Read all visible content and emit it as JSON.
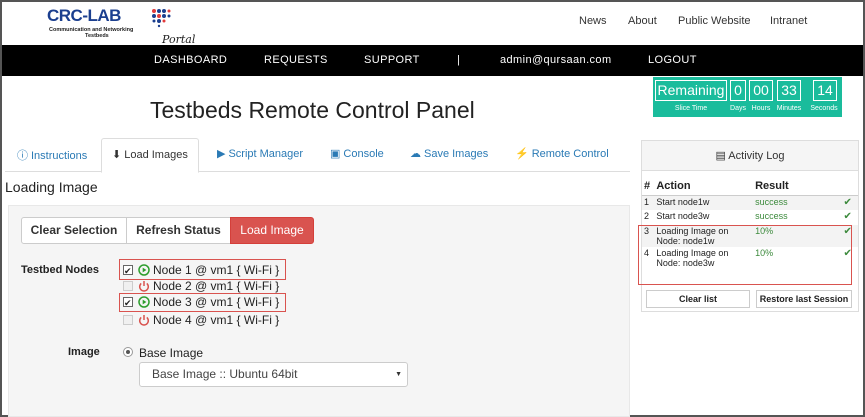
{
  "logo": {
    "main": "CRC-LAB",
    "sub_line1": "Communication and Networking",
    "sub_line2": "Testbeds",
    "portal": "Portal"
  },
  "top_nav": [
    "News",
    "About",
    "Public Website",
    "Intranet"
  ],
  "main_nav": [
    "DASHBOARD",
    "REQUESTS",
    "SUPPORT",
    "|",
    "admin@qursaan.com",
    "LOGOUT"
  ],
  "timer": {
    "label": "Remaining",
    "sublabel": "Slice Time",
    "days": "0",
    "hours": "00",
    "minutes": "33",
    "seconds": "14",
    "days_label": "Days",
    "hours_label": "Hours",
    "minutes_label": "Minutes",
    "seconds_label": "Seconds"
  },
  "page_title": "Testbeds Remote Control Panel",
  "tabs": [
    "Instructions",
    "Load Images",
    "Script Manager",
    "Console",
    "Save Images",
    "Remote Control"
  ],
  "section_title": "Loading Image",
  "buttons": {
    "clear": "Clear Selection",
    "refresh": "Refresh Status",
    "load": "Load Image"
  },
  "nodes_label": "Testbed Nodes",
  "nodes": [
    {
      "text": "Node 1 @ vm1 { Wi-Fi }",
      "checked": true,
      "state": "on"
    },
    {
      "text": "Node 2 @ vm1 { Wi-Fi }",
      "checked": false,
      "state": "off"
    },
    {
      "text": "Node 3 @ vm1 { Wi-Fi }",
      "checked": true,
      "state": "on"
    },
    {
      "text": "Node 4 @ vm1 { Wi-Fi }",
      "checked": false,
      "state": "off"
    }
  ],
  "image_label": "Image",
  "image_radio": "Base Image",
  "image_select": "Base Image :: Ubuntu 64bit",
  "activity_log": {
    "title": "Activity Log",
    "headers": [
      "#",
      "Action",
      "Result"
    ],
    "rows": [
      {
        "num": "1",
        "action": "Start node1w",
        "result": "success"
      },
      {
        "num": "2",
        "action": "Start node3w",
        "result": "success"
      },
      {
        "num": "3",
        "action": "Loading Image on Node: node1w",
        "result": "10%"
      },
      {
        "num": "4",
        "action": "Loading Image on Node: node3w",
        "result": "10%"
      }
    ],
    "clear_btn": "Clear list",
    "restore_btn": "Restore last Session"
  },
  "colors": {
    "accent": "#1abc9c",
    "danger": "#d9534f",
    "link": "#2a7ab5",
    "success": "#3c8a3c",
    "power_on": "#2e9e2e",
    "power_off": "#d9534f"
  }
}
